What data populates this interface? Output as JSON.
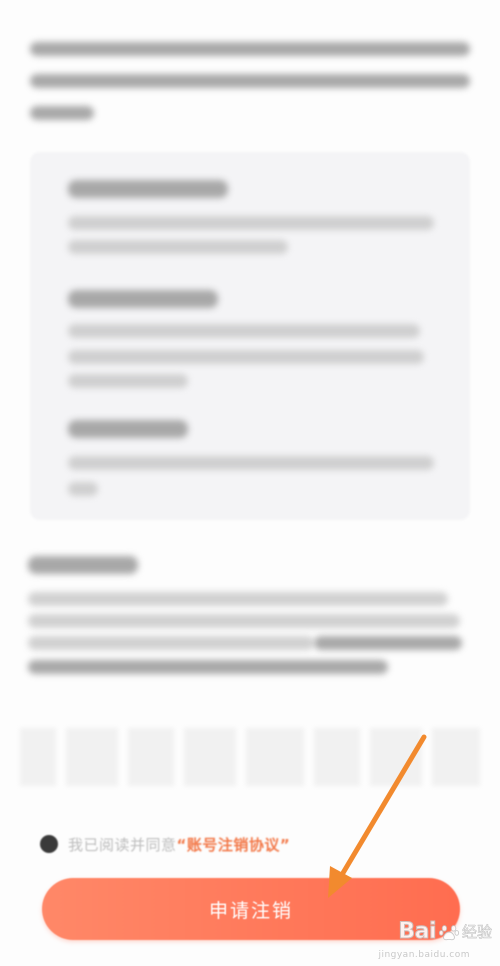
{
  "agreement": {
    "prefix": "我已阅读并同意",
    "link_label": "“账号注销协议”"
  },
  "apply_button": {
    "label": "申请注销"
  },
  "watermark": {
    "brand": "Bai",
    "brand_suffix": "经验",
    "url": "jingyan.baidu.com"
  },
  "colors": {
    "accent": "#ff6d50",
    "link": "#f27a4b",
    "arrow": "#f28a2e"
  },
  "icons": {
    "radio": "filled-radio-icon",
    "paw": "baidu-paw-icon",
    "arrow": "annotation-arrow"
  }
}
